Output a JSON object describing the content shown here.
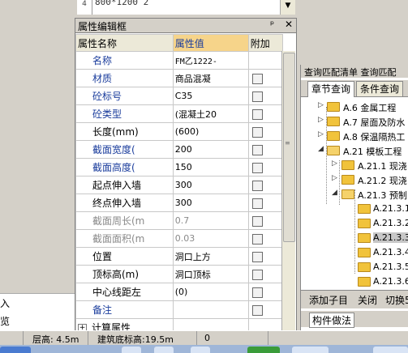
{
  "top_grid": {
    "row_text": "800*1200 2",
    "row_text2": "…"
  },
  "prop_panel": {
    "title": "属性编辑框",
    "pin": "ᵖ",
    "close": "✕",
    "headers": {
      "name": "属性名称",
      "value": "属性值",
      "extra": "附加"
    },
    "rows": [
      {
        "name": "名称",
        "value": "FM乙1222-"
      },
      {
        "name": "材质",
        "value": "商品混凝"
      },
      {
        "name": "砼标号",
        "value": "C35"
      },
      {
        "name": "砼类型",
        "value": "(混凝土20"
      },
      {
        "name": "长度(mm)",
        "value": "(600)"
      },
      {
        "name": "截面宽度(",
        "value": "200"
      },
      {
        "name": "截面高度(",
        "value": "150"
      },
      {
        "name": "起点伸入墙",
        "value": "300"
      },
      {
        "name": "终点伸入墙",
        "value": "300"
      },
      {
        "name": "截面周长(m",
        "value": "0.7"
      },
      {
        "name": "截面面积(m",
        "value": "0.03"
      },
      {
        "name": "位置",
        "value": "洞口上方"
      },
      {
        "name": "顶标高(m)",
        "value": "洞口顶标"
      },
      {
        "name": "中心线距左",
        "value": "(0)"
      },
      {
        "name": "备注",
        "value": ""
      },
      {
        "name": "计算属性",
        "value": ""
      }
    ]
  },
  "left_frag": {
    "line1": "入",
    "line2": "览"
  },
  "right_panel": {
    "header": "查询匹配清单  查询匹配",
    "tabs": [
      "章节查询",
      "条件查询"
    ],
    "tree": [
      {
        "label": "A.6 金属工程"
      },
      {
        "label": "A.7 屋面及防水"
      },
      {
        "label": "A.8 保温隔热工"
      },
      {
        "label": "A.21 模板工程"
      },
      {
        "label": "A.21.1 现浇"
      },
      {
        "label": "A.21.2 现浇"
      },
      {
        "label": "A.21.3 预制"
      },
      {
        "label": "A.21.3.1"
      },
      {
        "label": "A.21.3.2"
      },
      {
        "label": "A.21.3.3"
      },
      {
        "label": "A.21.3.4"
      },
      {
        "label": "A.21.3.5"
      },
      {
        "label": "A.21.3.6"
      }
    ],
    "bottom_buttons": [
      "添加子目",
      "关闭",
      "切换5"
    ],
    "footer_tab": "构件做法"
  },
  "statusbar": {
    "floor_height": "层高: 4.5m",
    "base_elevation": "建筑底标高:19.5m",
    "value": "0"
  },
  "colors": {
    "header_highlight": "#f6d48a",
    "blue_text": "#1a3c9c",
    "folder": "#f1c33b"
  }
}
